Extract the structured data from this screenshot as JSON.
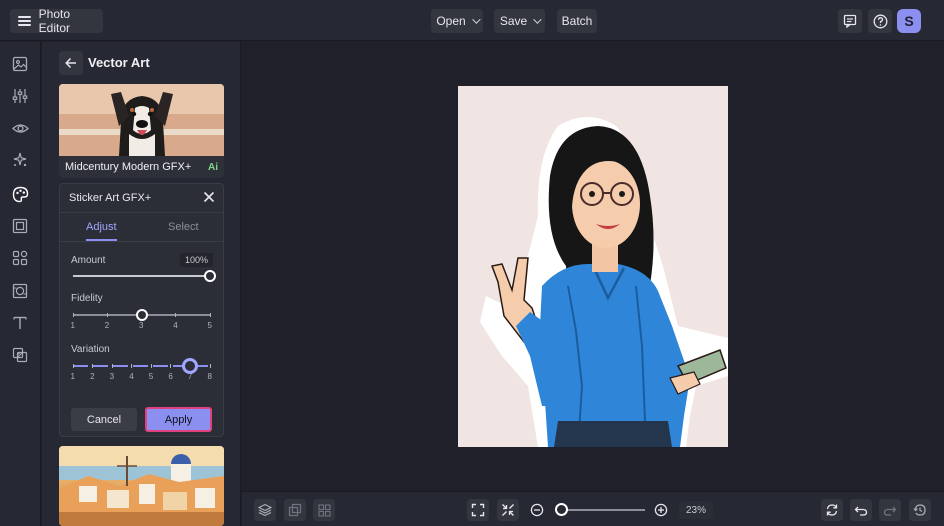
{
  "app": {
    "title": "Photo Editor"
  },
  "toolbar": {
    "open_label": "Open",
    "save_label": "Save",
    "batch_label": "Batch",
    "user_initial": "S"
  },
  "panel": {
    "title": "Vector Art",
    "card1": {
      "label": "Midcentury Modern GFX+",
      "badge": "Ai"
    },
    "dialog": {
      "title": "Sticker Art GFX+",
      "tabs": [
        {
          "label": "Adjust"
        },
        {
          "label": "Select"
        }
      ],
      "amount": {
        "label": "Amount",
        "value": "100%",
        "fraction": 1.0
      },
      "fidelity": {
        "label": "Fidelity",
        "ticks": [
          "1",
          "2",
          "3",
          "4",
          "5"
        ],
        "selected": 3
      },
      "variation": {
        "label": "Variation",
        "ticks": [
          "1",
          "2",
          "3",
          "4",
          "5",
          "6",
          "7",
          "8"
        ],
        "selected": 7
      },
      "cancel_label": "Cancel",
      "apply_label": "Apply"
    }
  },
  "zoom": {
    "value": "23%",
    "fraction": 0.0
  },
  "colors": {
    "accent": "#8a8ff0",
    "highlight": "#e0417f",
    "background": "#1f2029"
  }
}
